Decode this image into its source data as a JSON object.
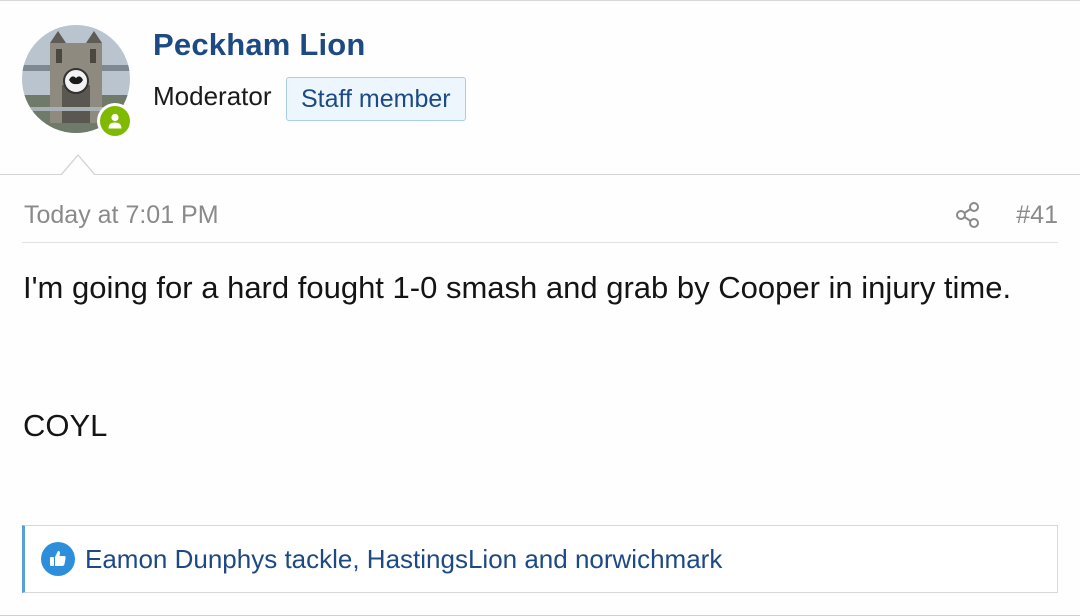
{
  "user": {
    "name": "Peckham Lion",
    "title": "Moderator",
    "badge": "Staff member",
    "avatar_icon": "tower-bridge-avatar",
    "status_icon": "online-user-icon",
    "status_color": "#7fb900"
  },
  "post": {
    "time": "Today at 7:01 PM",
    "number": "#41",
    "share_icon": "share-icon",
    "body_line1": "I'm going for a hard fought 1-0 smash and grab by Cooper in injury time.",
    "body_line2": "COYL"
  },
  "reactions": {
    "icon": "thumbs-up-icon",
    "text": "Eamon Dunphys tackle, HastingsLion and norwichmark",
    "accent_color": "#2d8fdb"
  },
  "colors": {
    "username": "#1d4a85",
    "badge_bg": "#edf6fd",
    "badge_border": "#a9cdea",
    "meta_text": "#8a8a8a"
  }
}
